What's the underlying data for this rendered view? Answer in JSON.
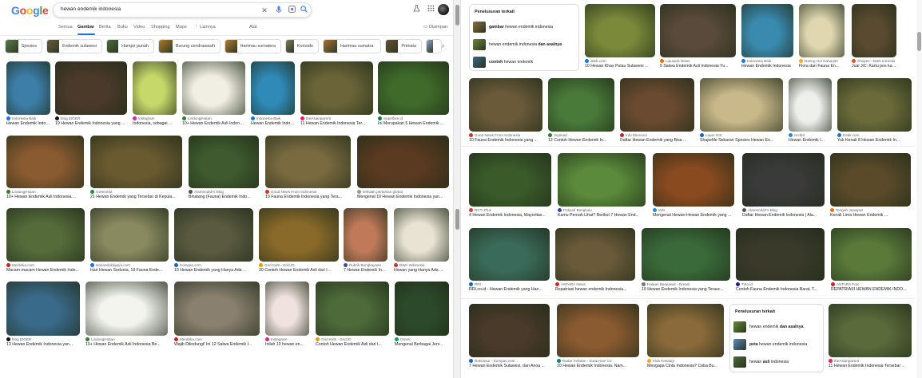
{
  "search": {
    "query": "hewan endemik indonesia"
  },
  "tabs": [
    {
      "label": "Semua"
    },
    {
      "label": "Gambar"
    },
    {
      "label": "Berita"
    },
    {
      "label": "Buku"
    },
    {
      "label": "Video"
    },
    {
      "label": "Shopping"
    },
    {
      "label": "Maps"
    },
    {
      "label": "⋮ Lainnya"
    },
    {
      "label": "Alat"
    }
  ],
  "safesearch_label": "Disimpan",
  "chips": [
    {
      "label": "Spesies",
      "color": "#5a7a4a"
    },
    {
      "label": "Endemik sulawesi",
      "color": "#6b5a3a"
    },
    {
      "label": "Hampir punah",
      "color": "#4a6a3a"
    },
    {
      "label": "Burung cendrawasih",
      "color": "#b07a2a"
    },
    {
      "label": "Harimau sumatera",
      "color": "#b5792f"
    },
    {
      "label": "Komodo",
      "color": "#7a7a5a"
    },
    {
      "label": "Harimau sumatra",
      "color": "#a96e30"
    },
    {
      "label": "Primata",
      "color": "#6a5030"
    },
    {
      "label": "",
      "color": "#8aa7c8"
    }
  ],
  "left_cards": [
    {
      "source": "Indonesia Baik",
      "title": "Hewan Endemik Indonesia",
      "fav": "#1a73e8",
      "bg": "#3c7ea8"
    },
    {
      "source": "blog EIGER",
      "title": "19 Hewan Endemik Indonesia yang ...",
      "fav": "#111111",
      "bg": "#4b3a2a"
    },
    {
      "source": "Instagram",
      "title": "Indonesia, sebagai ...",
      "fav": "#d6249f",
      "bg": "#c7d86a"
    },
    {
      "source": "LindungiHutan",
      "title": "10+ Hewan Endemik Asli Indonesia ...",
      "fav": "#2e7d32",
      "bg": "#f1efe3"
    },
    {
      "source": "Indonesia Baik",
      "title": "Hewan Endemik Indonesia",
      "fav": "#1a73e8",
      "bg": "#2f8ab7"
    },
    {
      "source": "theAsianparent",
      "title": "11 Hewan Endemik Indonesia Ter...",
      "fav": "#e91e63",
      "bg": "#6a6438"
    },
    {
      "source": "Superlive id",
      "title": "Ini Merupakan 5 Hewan Endemik ...",
      "fav": "#0b8043",
      "bg": "#3f6a2a"
    },
    {
      "source": "LindungiHutan",
      "title": "10+ Hewan Endemik Asli Indonesia ...",
      "fav": "#2e7d32",
      "bg": "#8a5a30"
    },
    {
      "source": "Greeneda",
      "title": "21 Hewan Endemik yang Tersebar di Kepula...",
      "fav": "#1e8e3e",
      "bg": "#6a5a30"
    },
    {
      "source": "Alamendah's Blog",
      "title": "Binatang (Fauna) Endemik Indo...",
      "fav": "#555555",
      "bg": "#3e5a2e"
    },
    {
      "source": "Good News From Indonesia",
      "title": "10 Fauna Endemik Indonesia yang Tera...",
      "fav": "#d93025",
      "bg": "#7a6a40"
    },
    {
      "source": "sekolah pertanian global",
      "title": "Mengenal 10 Hewan Endemik Indonesia yan...",
      "fav": "#999999",
      "bg": "#5a3a20"
    },
    {
      "source": "Merdeka.com",
      "title": "Macam-macam Hewan Endemik Indo...",
      "fav": "#c5221f",
      "bg": "#556b3a"
    },
    {
      "source": "Hariandaklajaya.com",
      "title": "Hari Hewan Sedunia, 19 Fauna Ende...",
      "fav": "#1a73e8",
      "bg": "#8a8a60"
    },
    {
      "source": "Kompas.com",
      "title": "10 Hewan Endemik yang Hanya Ada ...",
      "fav": "#1565c0",
      "bg": "#5a5a40"
    },
    {
      "source": "Grid Kids - Grid.ID",
      "title": "20 Contoh Hewan Endemik Asli dari I...",
      "fav": "#f29900",
      "bg": "#8a6a2a"
    },
    {
      "source": "Rubrik Bengkayaan",
      "title": "7 Hewan Endemik Ind...",
      "fav": "#3949ab",
      "bg": "#c07a5a"
    },
    {
      "source": "DWA Indonesia",
      "title": "Hewan yang Hanya Ada ...",
      "fav": "#d32f2f",
      "bg": "#e9e3d3"
    },
    {
      "source": "blog EIGER",
      "title": "13 Hewan Endemik Indonesia yan...",
      "fav": "#111111",
      "bg": "#3a6a8a"
    },
    {
      "source": "LindungiHutan",
      "title": "10+ Hewan Endemik Asli Indonesia Be...",
      "fav": "#2e7d32",
      "bg": "#f4f4ef"
    },
    {
      "source": "Merdeka.com",
      "title": "Wajib Dilindungi! Ini 12 Satwa Endemik I...",
      "fav": "#c5221f",
      "bg": "#8a8070"
    },
    {
      "source": "Instagram",
      "title": "Inilah 10 hewan en...",
      "fav": "#d6249f",
      "bg": "#f0e2de"
    },
    {
      "source": "Grid Kids - Grid.ID",
      "title": "Contoh Hewan Endemik Asli dari I...",
      "fav": "#f29900",
      "bg": "#4d6a3a"
    },
    {
      "source": "Oreinc",
      "title": "Mengenal Berbagai Jeni...",
      "fav": "#0f9d58",
      "bg": "#2c4a2a"
    }
  ],
  "related_top": {
    "title": "Penelusuran terkait",
    "items": [
      {
        "pre": "",
        "bold": "gambar",
        "post": " hewan endemik indonesia",
        "color": "#8a7040"
      },
      {
        "pre": "hewan endemik indonesia ",
        "bold": "dan asalnya",
        "post": "",
        "color": "#6a8a3a"
      },
      {
        "pre": "",
        "bold": "contoh",
        "post": " hewan endemik",
        "color": "#3a6a8a"
      }
    ]
  },
  "related_bottom": {
    "title": "Penelusuran terkait",
    "items": [
      {
        "pre": "hewan endemik ",
        "bold": "dan asalnya",
        "post": "",
        "color": "#6a8a3a"
      },
      {
        "pre": "",
        "bold": "peta",
        "post": " hewan endemik indonesia",
        "color": "#5a8ac0"
      },
      {
        "pre": "hewan ",
        "bold": "asli",
        "post": " indonesia",
        "color": "#4a6a3a"
      }
    ]
  },
  "right_cards": [
    {
      "source": "detik.com",
      "title": "10 Hewan Khas Pulau Sulawesi ...",
      "fav": "#1a73e8",
      "bg": "#7a8a3a"
    },
    {
      "source": "Liputan6 News",
      "title": "5 Satwa Endemik Asli Indonesia Yu...",
      "fav": "#ef6c00",
      "bg": "#5a4a3a"
    },
    {
      "source": "Indonesia Baik",
      "title": "Hewan Endemik Indonesia",
      "fav": "#1a73e8",
      "bg": "#3a8ab0"
    },
    {
      "source": "Daring Hut Raharjah",
      "title": "Flora dan Fauna En...",
      "fav": "#f9a825",
      "bg": "#e0d7b0"
    },
    {
      "source": "Shopee - Bisik Iemedia",
      "title": "Jual JiC: Kartu pos kartupo...",
      "fav": "#ee4d2d",
      "bg": "#5a4a30"
    },
    {
      "source": "Good News From Indonesia",
      "title": "10 Fauna Endemik Indonesia yang ...",
      "fav": "#d93025",
      "bg": "#6a5a3a"
    },
    {
      "source": "Vupload",
      "title": "12 Contoh Hewan Endemik In...",
      "fav": "#2e7d32",
      "bg": "#4a7a3a"
    },
    {
      "source": "Info Ekonomi",
      "title": "Daftar Hewan Endemik yang Bisa ...",
      "fav": "#c62828",
      "bg": "#6a4a30"
    },
    {
      "source": "Layer GIS",
      "title": "Shapefile Sebaran Spesies Hewan En...",
      "fav": "#1565c0",
      "bg": "#c9b88a"
    },
    {
      "source": "Scribd",
      "title": "Hewan Endemik I...",
      "fav": "#1e88e5",
      "bg": "#eef0ec"
    },
    {
      "source": "Detik.com",
      "title": "Yuk Kenali 8 Hewan Endemik In...",
      "fav": "#1a73e8",
      "bg": "#6a6a3a"
    },
    {
      "source": "RCTI Plus",
      "title": "4 Hewan Endemik Indonesia, Mayoritas...",
      "fav": "#e53935",
      "bg": "#3a5a2a"
    },
    {
      "source": "Pokyah Bengkulu",
      "title": "Kamu Pernah Lihat? Berikut 7 Hewan End...",
      "fav": "#3949ab",
      "bg": "#5a8a3a"
    },
    {
      "source": "IDN",
      "title": "Mengenal Hewan-Hewan Endemik yang ...",
      "fav": "#1e88e5",
      "bg": "#8a4a20"
    },
    {
      "source": "Alamendah's Blog",
      "title": "Daftar Hewan Endemik Indonesia | Ala...",
      "fav": "#555555",
      "bg": "#3a3a3a"
    },
    {
      "source": "Tengah Jawapos",
      "title": "Kenali Lima Hewan Endemik ...",
      "fav": "#ff6f00",
      "bg": "#5a4a2a"
    },
    {
      "source": "RRI",
      "title": "RRI.co.id - Hewan Endemik yang Han...",
      "fav": "#1565c0",
      "bg": "#3a6a5a"
    },
    {
      "source": "ANTARA News",
      "title": "Repatriasi hewan endemik Indonesia...",
      "fav": "#c62828",
      "bg": "#6a5a3a"
    },
    {
      "source": "Halaan Banjuwas - Dream",
      "title": "10 Hewan Endemik Indonesia yang Terasc...",
      "fav": "#777777",
      "bg": "#3a6a3a"
    },
    {
      "source": "Tirto.id",
      "title": "Contoh Fauna Endemik Indonesia Barat, T...",
      "fav": "#1a237e",
      "bg": "#3a3a2a"
    },
    {
      "source": "ANTARA Foto",
      "title": "REPATRIASI HEWAN ENDEMIK INDO...",
      "fav": "#c62828",
      "bg": "#5a7a3a"
    },
    {
      "source": "Rakusaur - Kompas.com",
      "title": "7 Hewan Endemik Sulawesi, dari Anoa ...",
      "fav": "#1565c0",
      "bg": "#4a3a2a"
    },
    {
      "source": "Radar Solatan - SuaLenan Co",
      "title": "10 Hewan Endemik Indonesia. Nam...",
      "fav": "#00897b",
      "bg": "#8a5a30"
    },
    {
      "source": "Kids Kasadgi",
      "title": "Mengapa Cinta Indonesia? Coba Bu...",
      "fav": "#f9a825",
      "bg": "#8a6a3a"
    },
    {
      "source": "theAsianparent",
      "title": "11 Hewan Endemik Indonesia Tersebar ...",
      "fav": "#e91e63",
      "bg": "#5a6a3a"
    }
  ]
}
